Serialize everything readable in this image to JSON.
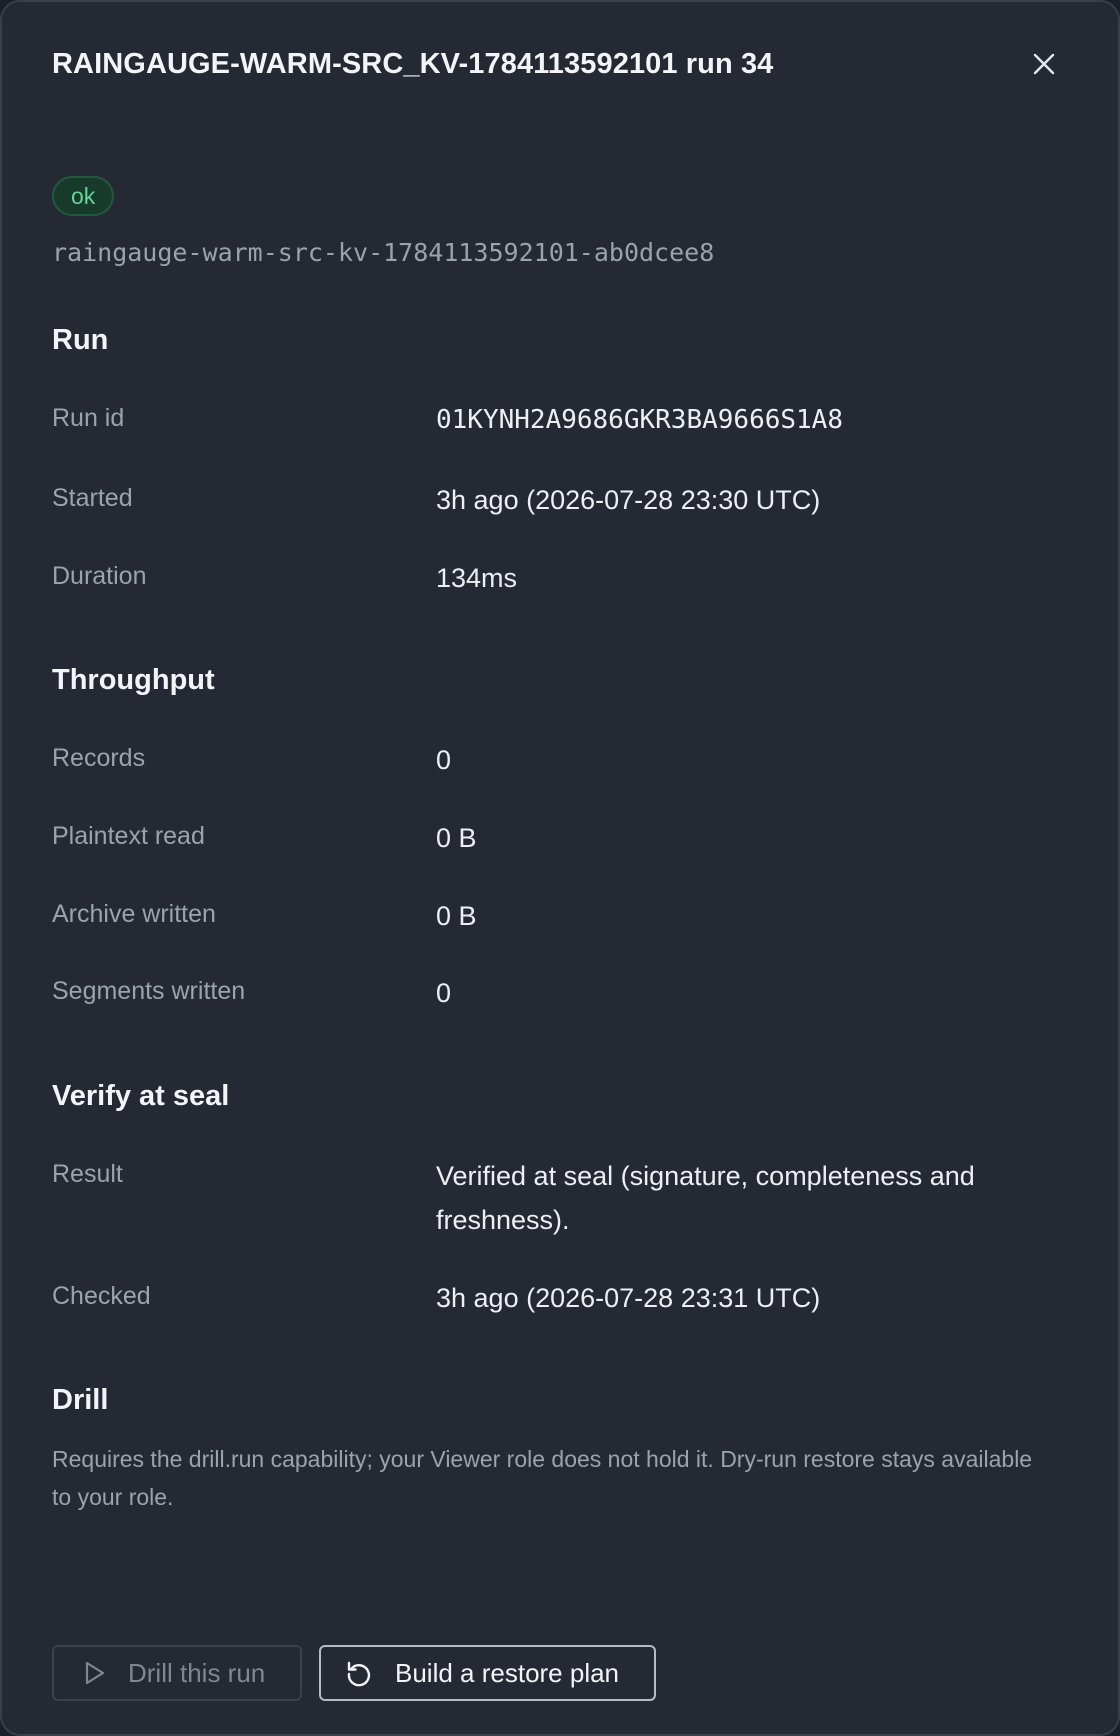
{
  "panel": {
    "title": "RAINGAUGE-WARM-SRC_KV-1784113592101 run 34",
    "close_icon": "close-icon"
  },
  "status": {
    "badge": "ok",
    "slug": "raingauge-warm-src-kv-1784113592101-ab0dcee8"
  },
  "run": {
    "heading": "Run",
    "rows": [
      {
        "label": "Run id",
        "value": "01KYNH2A9686GKR3BA9666S1A8"
      },
      {
        "label": "Started",
        "value": "3h ago (2026-07-28 23:30 UTC)"
      },
      {
        "label": "Duration",
        "value": "134ms"
      }
    ]
  },
  "throughput": {
    "heading": "Throughput",
    "rows": [
      {
        "label": "Records",
        "value": "0"
      },
      {
        "label": "Plaintext read",
        "value": "0 B"
      },
      {
        "label": "Archive written",
        "value": "0 B"
      },
      {
        "label": "Segments written",
        "value": "0"
      }
    ]
  },
  "verify": {
    "heading": "Verify at seal",
    "rows": [
      {
        "label": "Result",
        "value": "Verified at seal (signature, completeness and freshness)."
      },
      {
        "label": "Checked",
        "value": "3h ago (2026-07-28 23:31 UTC)"
      }
    ]
  },
  "drill": {
    "heading": "Drill",
    "note": "Requires the drill.run capability; your Viewer role does not hold it. Dry-run restore stays available to your role."
  },
  "actions": {
    "drill_label": "Drill this run",
    "drill_icon": "play-icon",
    "restore_label": "Build a restore plan",
    "restore_icon": "restore-icon"
  },
  "colors": {
    "panel_bg": "#242933",
    "badge_text": "#66d39a",
    "badge_bg": "#173a2b"
  }
}
